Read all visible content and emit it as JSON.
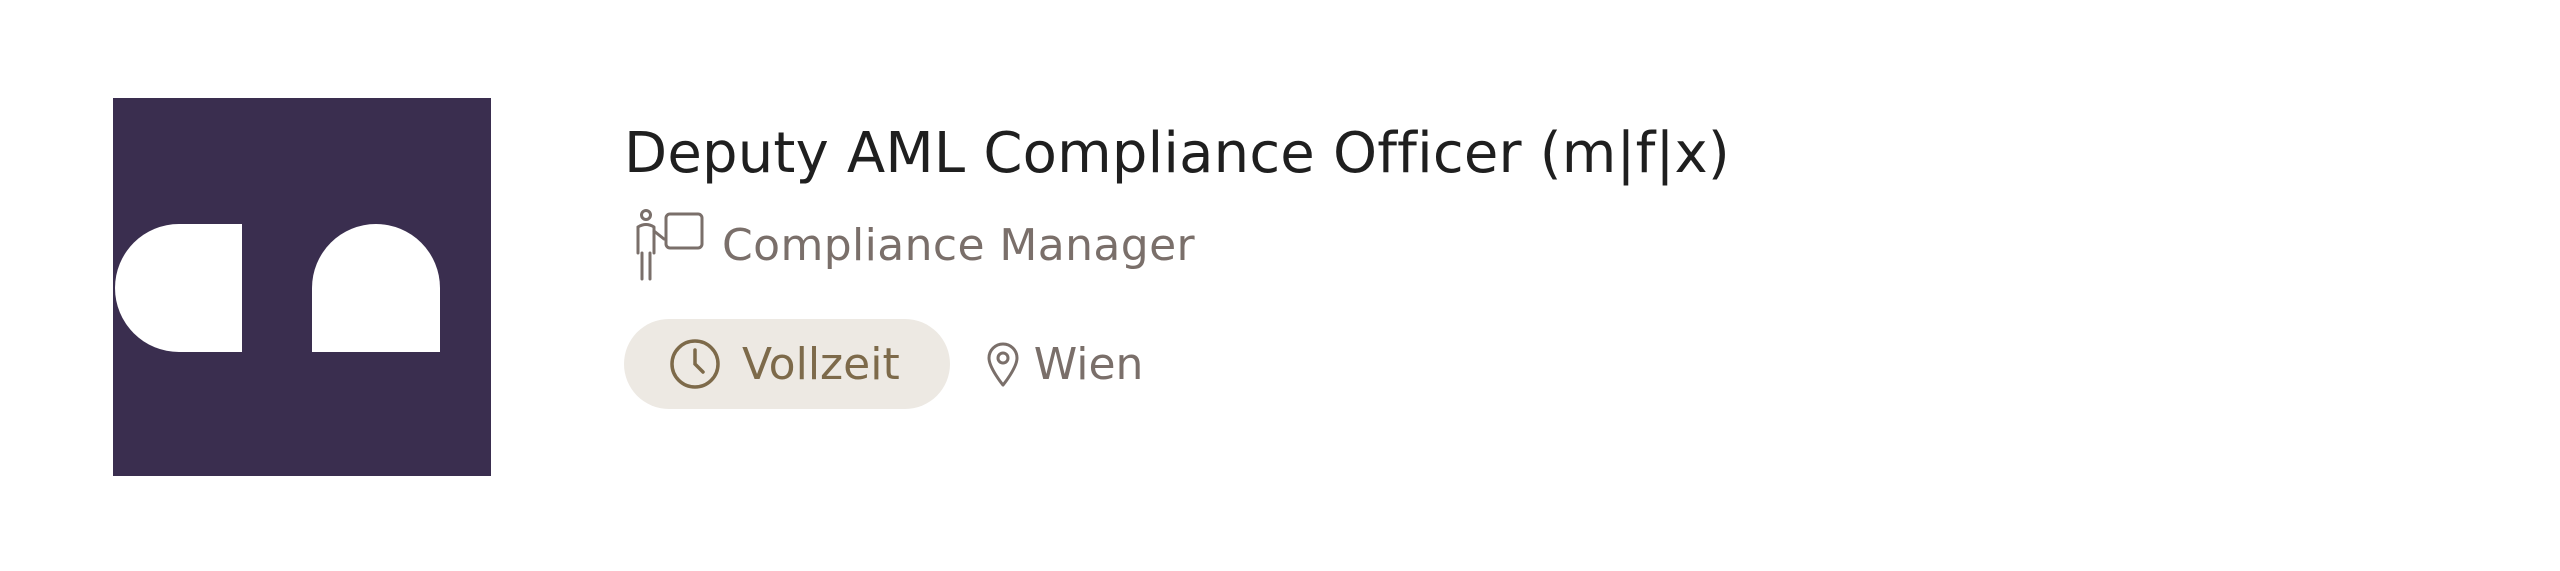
{
  "job": {
    "title": "Deputy AML Compliance Officer (m|f|x)",
    "category": "Compliance Manager",
    "employment_type": "Vollzeit",
    "location": "Wien"
  },
  "icons": {
    "category": "presenter-board-icon",
    "employment_type": "clock-icon",
    "location": "map-pin-icon"
  },
  "colors": {
    "logo_background": "#3a2e4f",
    "logo_shape": "#ffffff",
    "title": "#1f1f1f",
    "meta_text": "#7a6f6a",
    "pill_background": "#ede9e3",
    "pill_text": "#7d6a4a"
  }
}
